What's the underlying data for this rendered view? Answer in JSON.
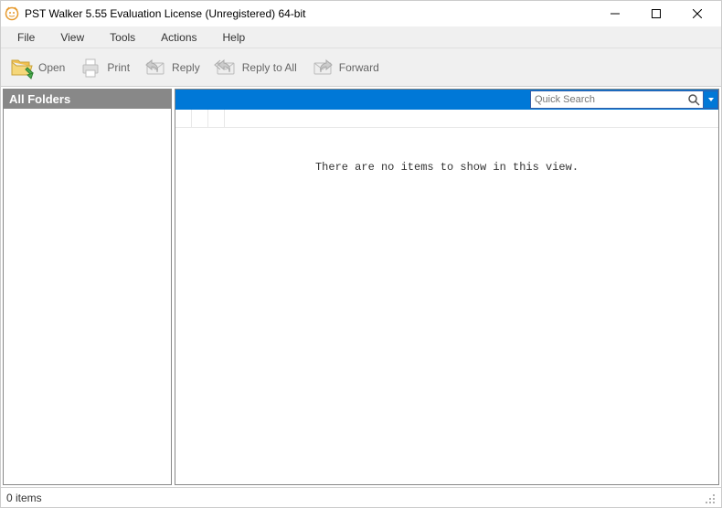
{
  "titlebar": {
    "title": "PST Walker 5.55 Evaluation License (Unregistered) 64-bit"
  },
  "menubar": {
    "items": [
      "File",
      "View",
      "Tools",
      "Actions",
      "Help"
    ]
  },
  "toolbar": {
    "open": {
      "label": "Open"
    },
    "print": {
      "label": "Print"
    },
    "reply": {
      "label": "Reply"
    },
    "reply_all": {
      "label": "Reply to All"
    },
    "forward": {
      "label": "Forward"
    }
  },
  "left_panel": {
    "header": "All Folders"
  },
  "right_panel": {
    "search_placeholder": "Quick Search",
    "empty_message": "There are no items to show in this view."
  },
  "statusbar": {
    "text": "0 items"
  }
}
